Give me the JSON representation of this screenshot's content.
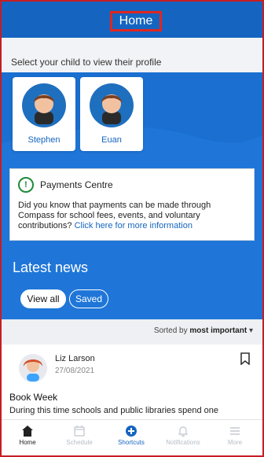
{
  "header": {
    "title": "Home"
  },
  "children_prompt": "Select your child to view their profile",
  "children": [
    {
      "name": "Stephen"
    },
    {
      "name": "Euan"
    }
  ],
  "payments": {
    "title": "Payments Centre",
    "body": "Did you know that payments can be made through Compass for school fees, events, and voluntary contributions?",
    "link": "Click here for more information"
  },
  "news": {
    "title": "Latest news",
    "filters": [
      "View all",
      "Saved"
    ],
    "sort_prefix": "Sorted by",
    "sort_value": "most important",
    "post": {
      "author": "Liz Larson",
      "date": "27/08/2021",
      "title": "Book Week",
      "snippet": "During this time schools and public libraries spend one"
    }
  },
  "bottom_nav": {
    "items": [
      {
        "label": "Home",
        "icon": "home-icon"
      },
      {
        "label": "Schedule",
        "icon": "calendar-icon"
      },
      {
        "label": "Shortcuts",
        "icon": "plus-circle-icon"
      },
      {
        "label": "Notifications",
        "icon": "bell-icon"
      },
      {
        "label": "More",
        "icon": "menu-icon"
      }
    ]
  },
  "colors": {
    "primary": "#1565c0",
    "title_highlight": "#e0261f",
    "payments_accent": "#1f8a3a"
  }
}
